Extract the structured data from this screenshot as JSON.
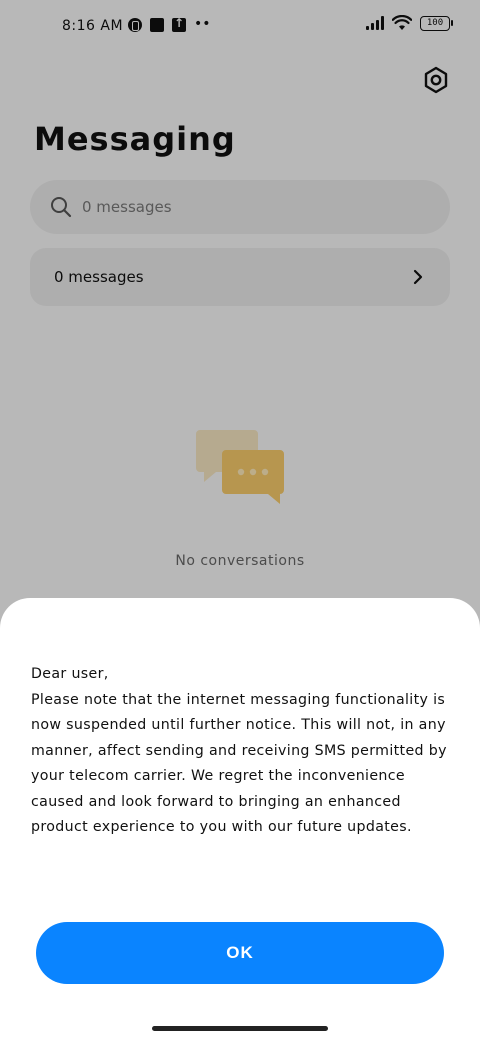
{
  "status_bar": {
    "time": "8:16 AM",
    "battery": "100",
    "icons": [
      "notification-r-icon",
      "square-app-icon",
      "upload-icon",
      "more-dots-icon",
      "signal-icon",
      "wifi-icon",
      "battery-icon"
    ]
  },
  "header": {
    "title": "Messaging",
    "settings_icon": "settings-hexagon-icon"
  },
  "search": {
    "placeholder": "0 messages"
  },
  "messages_row": {
    "label": "0 messages"
  },
  "empty_state": {
    "text": "No conversations",
    "icon": "chat-bubbles-icon"
  },
  "dialog": {
    "greeting": "Dear user,",
    "body": "Please note that the internet messaging functionality is now suspended until further notice. This will not, in any manner,  affect sending and receiving SMS permitted by your telecom carrier. We regret the inconvenience caused and look forward to bringing an enhanced product experience to you with our future updates.",
    "ok_label": "OK"
  },
  "colors": {
    "accent": "#0a84ff",
    "illustration": "#f4c96a"
  }
}
